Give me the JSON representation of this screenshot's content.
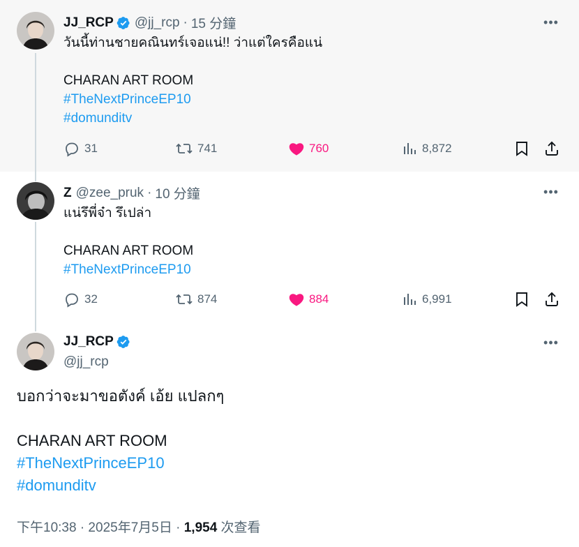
{
  "tweets": [
    {
      "name": "JJ_RCP",
      "verified": true,
      "handle": "@jj_rcp",
      "time": "15 分鐘",
      "lines": [
        "วันนี้ท่านชายคณินทร์เจอแน่!! ว่าแต่ใครคือแน่",
        "",
        "CHARAN ART ROOM",
        "#TheNextPrinceEP10",
        "#domunditv"
      ],
      "replies": "31",
      "reposts": "741",
      "likes": "760",
      "views": "8,872"
    },
    {
      "name": "Z",
      "verified": false,
      "handle": "@zee_pruk",
      "time": "10 分鐘",
      "lines": [
        "แน่รึพี่จ๋า รึเปล่า",
        "",
        "CHARAN ART ROOM",
        "#TheNextPrinceEP10"
      ],
      "replies": "32",
      "reposts": "874",
      "likes": "884",
      "views": "6,991"
    }
  ],
  "main_tweet": {
    "name": "JJ_RCP",
    "verified": true,
    "handle": "@jj_rcp",
    "lines": [
      "บอกว่าจะมาขอตังค์ เอ้ย แปลกๆ",
      "",
      "CHARAN ART ROOM",
      "#TheNextPrinceEP10",
      "#domunditv"
    ],
    "timestamp": "下午10:38 · 2025年7月5日 · ",
    "views_count": "1,954",
    "views_label": " 次查看"
  },
  "colors": {
    "accent": "#1d9bf0",
    "like": "#f91880",
    "muted": "#536471",
    "text": "#0f1419",
    "thread_line": "#cfd9de"
  },
  "icons": [
    "verified-badge-icon",
    "more-icon",
    "reply-icon",
    "repost-icon",
    "like-icon",
    "views-icon",
    "bookmark-icon",
    "share-icon"
  ]
}
